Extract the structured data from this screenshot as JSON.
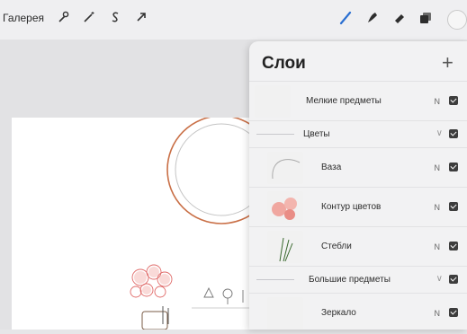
{
  "toolbar": {
    "gallery_label": "Галерея",
    "left_icons": [
      "wrench-icon",
      "magic-wand-icon",
      "selection-s-icon",
      "transform-arrow-icon"
    ],
    "right_icons": [
      "brush-icon",
      "smudge-icon",
      "eraser-icon",
      "layers-icon",
      "color-circle-icon"
    ],
    "accent_color": "#2a6fd1"
  },
  "layers_panel": {
    "title": "Слои",
    "add_symbol": "+",
    "layers": [
      {
        "name": "Мелкие предметы",
        "blend": "N",
        "visible": true,
        "type": "layer"
      },
      {
        "name": "Цветы",
        "visible": true,
        "type": "group",
        "expanded": true
      },
      {
        "name": "Ваза",
        "blend": "N",
        "visible": true,
        "type": "layer",
        "indent": true
      },
      {
        "name": "Контур цветов",
        "blend": "N",
        "visible": true,
        "type": "layer",
        "indent": true
      },
      {
        "name": "Стебли",
        "blend": "N",
        "visible": true,
        "type": "layer",
        "indent": true
      },
      {
        "name": "Большие предметы",
        "visible": true,
        "type": "group",
        "expanded": true
      },
      {
        "name": "Зеркало",
        "blend": "N",
        "visible": true,
        "type": "layer",
        "indent": true
      }
    ]
  }
}
